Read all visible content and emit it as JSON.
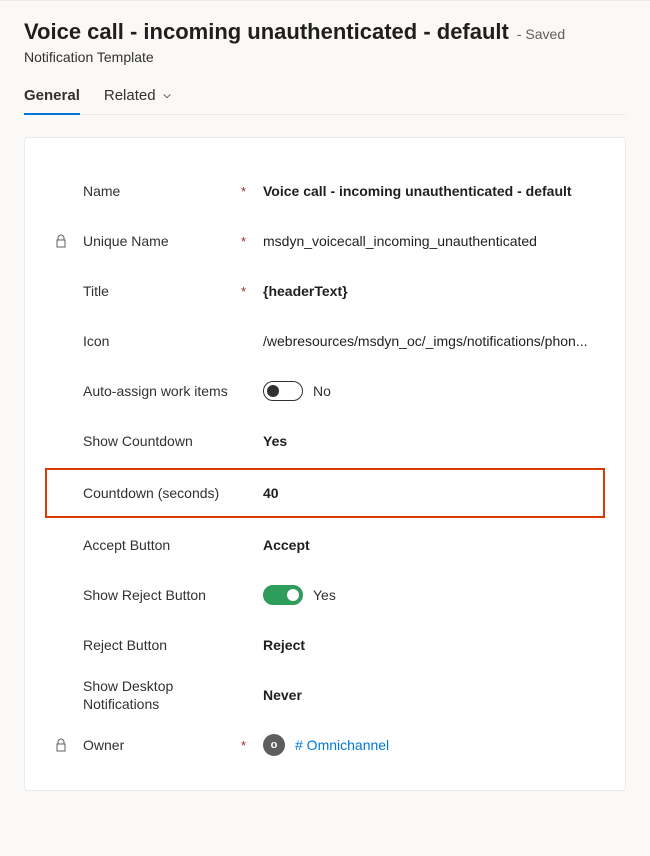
{
  "header": {
    "title": "Voice call - incoming unauthenticated - default",
    "savedLabel": "- Saved",
    "subtitle": "Notification Template"
  },
  "tabs": {
    "general": "General",
    "related": "Related"
  },
  "fields": {
    "name": {
      "label": "Name",
      "value": "Voice call - incoming unauthenticated - default"
    },
    "uniqueName": {
      "label": "Unique Name",
      "value": "msdyn_voicecall_incoming_unauthenticated"
    },
    "titleField": {
      "label": "Title",
      "value": "{headerText}"
    },
    "icon": {
      "label": "Icon",
      "value": "/webresources/msdyn_oc/_imgs/notifications/phon..."
    },
    "autoAssign": {
      "label": "Auto-assign work items",
      "toggleText": "No"
    },
    "showCountdown": {
      "label": "Show Countdown",
      "value": "Yes"
    },
    "countdown": {
      "label": "Countdown (seconds)",
      "value": "40"
    },
    "acceptButton": {
      "label": "Accept Button",
      "value": "Accept"
    },
    "showReject": {
      "label": "Show Reject Button",
      "toggleText": "Yes"
    },
    "rejectButton": {
      "label": "Reject Button",
      "value": "Reject"
    },
    "desktopNotif": {
      "label": "Show Desktop Notifications",
      "value": "Never"
    },
    "owner": {
      "label": "Owner",
      "initial": "o",
      "link": "# Omnichannel"
    }
  },
  "requiredMark": "*"
}
